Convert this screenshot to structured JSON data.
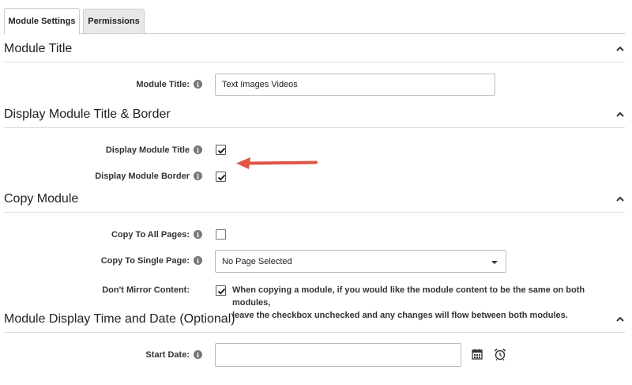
{
  "tabs": [
    {
      "label": "Module Settings",
      "active": true
    },
    {
      "label": "Permissions",
      "active": false
    }
  ],
  "sections": {
    "module_title": {
      "heading": "Module Title",
      "field_label": "Module Title:",
      "field_value": "Text Images Videos"
    },
    "display": {
      "heading": "Display Module Title & Border",
      "display_title_label": "Display Module Title",
      "display_title_checked": true,
      "display_border_label": "Display Module Border",
      "display_border_checked": true
    },
    "copy": {
      "heading": "Copy Module",
      "copy_all_label": "Copy To All Pages:",
      "copy_all_checked": false,
      "copy_single_label": "Copy To Single Page:",
      "copy_single_value": "No Page Selected",
      "mirror_label": "Don't Mirror Content:",
      "mirror_checked": true,
      "mirror_desc_line1": "When copying a module, if you would like the module content to be the same on both modules,",
      "mirror_desc_line2": "leave the checkbox unchecked and any changes will flow between both modules."
    },
    "time": {
      "heading": "Module Display Time and Date (Optional)",
      "start_label": "Start Date:",
      "start_value": ""
    }
  },
  "icons": {
    "info": "info-icon",
    "calendar": "calendar-icon",
    "alarm": "alarm-clock-icon",
    "chevron": "chevron-up-icon",
    "arrow": "red-arrow-annotation"
  },
  "colors": {
    "arrow": "#e05545",
    "info_icon": "#777777",
    "tab_inactive_bg": "#e8e8e8"
  }
}
